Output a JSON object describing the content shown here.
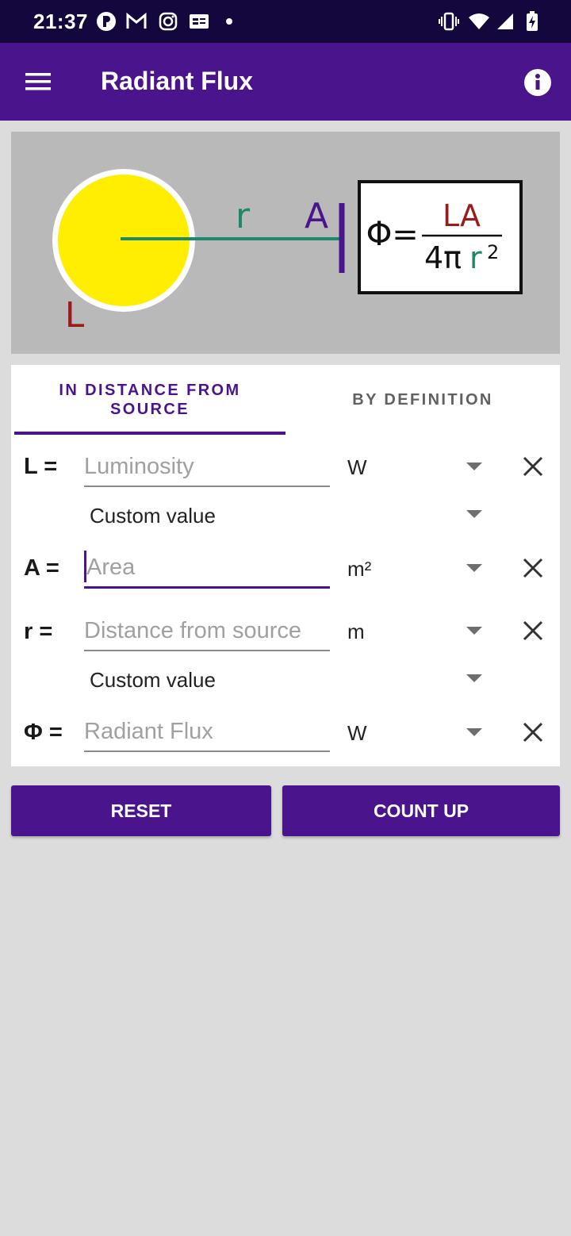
{
  "status_bar": {
    "time": "21:37"
  },
  "app_bar": {
    "title": "Radiant Flux",
    "menu_icon": "hamburger-menu-icon",
    "info_icon": "info-icon"
  },
  "illustration": {
    "source_label": "L",
    "distance_label": "r",
    "area_label": "A",
    "formula": {
      "lhs": "Φ",
      "equals": "=",
      "numerator": "LA",
      "denominator_prefix": "4π",
      "denominator_var": "r",
      "denominator_exp": "2"
    },
    "colors": {
      "background": "#b9b9b9",
      "sun": "#ffee00",
      "luminosity": "#9b1b1b",
      "distance": "#1a8a6a",
      "area": "#4a148c"
    }
  },
  "tabs": [
    {
      "label": "IN DISTANCE FROM SOURCE",
      "selected": true
    },
    {
      "label": "BY DEFINITION",
      "selected": false
    }
  ],
  "rows": {
    "luminosity": {
      "label": "L =",
      "placeholder": "Luminosity",
      "unit": "W",
      "preset": "Custom value"
    },
    "area": {
      "label": "A =",
      "placeholder": "Area",
      "unit": "m²"
    },
    "distance": {
      "label": "r =",
      "placeholder": "Distance from source",
      "unit": "m",
      "preset": "Custom value"
    },
    "flux": {
      "label": "Φ =",
      "placeholder": "Radiant Flux",
      "unit": "W"
    }
  },
  "buttons": {
    "reset": "RESET",
    "count_up": "COUNT UP"
  },
  "theme": {
    "primary": "#4a148c",
    "status_bar": "#13073e",
    "page_background": "#dcdcdc"
  }
}
